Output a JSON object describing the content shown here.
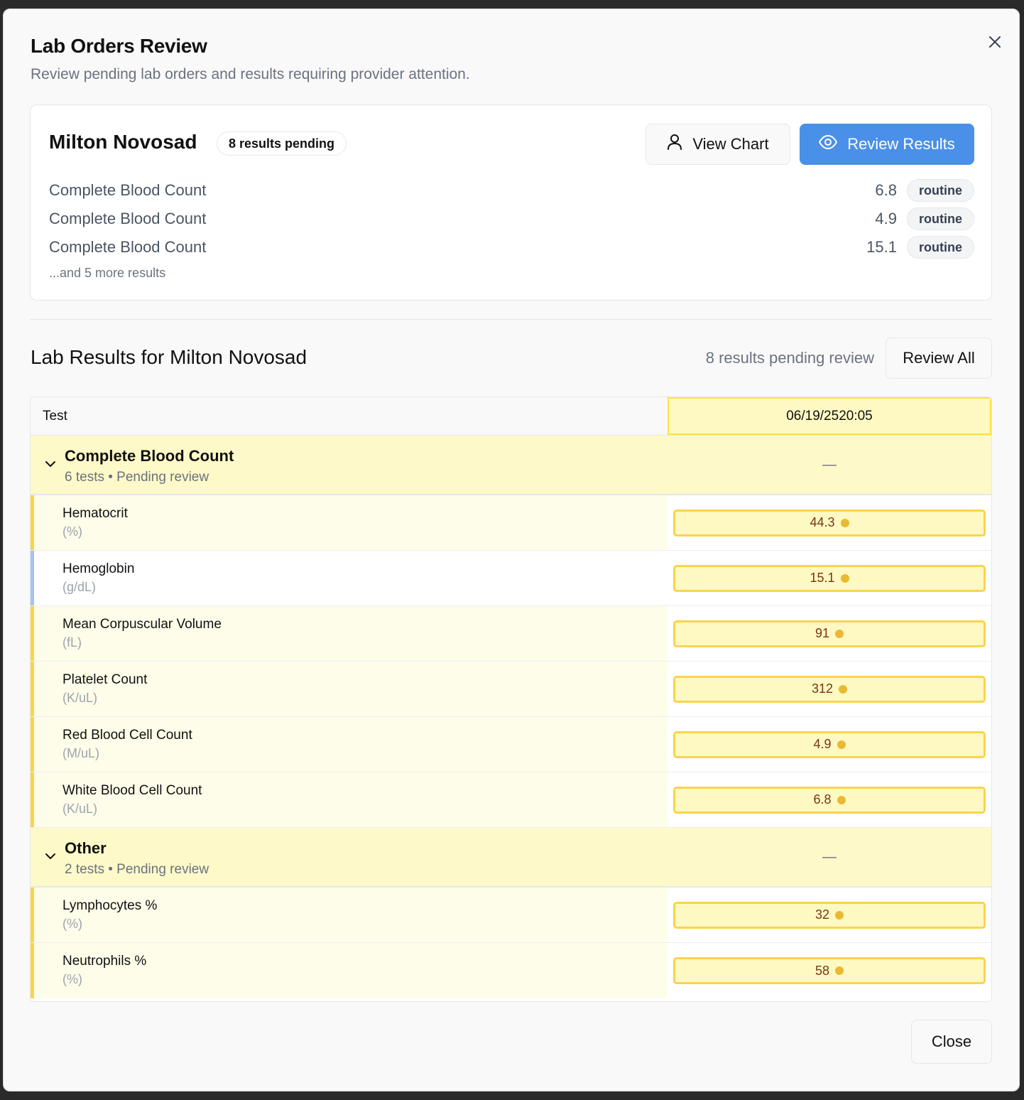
{
  "dialog": {
    "title": "Lab Orders Review",
    "subtitle": "Review pending lab orders and results requiring provider attention.",
    "close_icon": "close-icon"
  },
  "summary": {
    "patient_name": "Milton Novosad",
    "pending_badge": "8 results pending",
    "view_chart_label": "View Chart",
    "view_chart_icon": "user-icon",
    "review_results_label": "Review Results",
    "review_results_icon": "eye-icon",
    "rows": [
      {
        "name": "Complete Blood Count",
        "value": "6.8",
        "priority": "routine"
      },
      {
        "name": "Complete Blood Count",
        "value": "4.9",
        "priority": "routine"
      },
      {
        "name": "Complete Blood Count",
        "value": "15.1",
        "priority": "routine"
      }
    ],
    "more_text": "...and 5 more results"
  },
  "results": {
    "title": "Lab Results for Milton Novosad",
    "pending_text": "8 results pending review",
    "review_all_label": "Review All",
    "columns": {
      "test": "Test",
      "date": "06/19/2520:05"
    },
    "groups": [
      {
        "name": "Complete Blood Count",
        "meta": "6 tests • Pending review",
        "summary_value": "—",
        "tests": [
          {
            "name": "Hematocrit",
            "unit": "(%)",
            "value": "44.3",
            "flag": "pending"
          },
          {
            "name": "Hemoglobin",
            "unit": "(g/dL)",
            "value": "15.1",
            "flag": "normal"
          },
          {
            "name": "Mean Corpuscular Volume",
            "unit": "(fL)",
            "value": "91",
            "flag": "pending"
          },
          {
            "name": "Platelet Count",
            "unit": "(K/uL)",
            "value": "312",
            "flag": "pending"
          },
          {
            "name": "Red Blood Cell Count",
            "unit": "(M/uL)",
            "value": "4.9",
            "flag": "pending"
          },
          {
            "name": "White Blood Cell Count",
            "unit": "(K/uL)",
            "value": "6.8",
            "flag": "pending"
          }
        ]
      },
      {
        "name": "Other",
        "meta": "2 tests • Pending review",
        "summary_value": "—",
        "tests": [
          {
            "name": "Lymphocytes %",
            "unit": "(%)",
            "value": "32",
            "flag": "pending"
          },
          {
            "name": "Neutrophils %",
            "unit": "(%)",
            "value": "58",
            "flag": "pending"
          }
        ]
      }
    ]
  },
  "footer": {
    "close_label": "Close"
  },
  "colors": {
    "primary": "#4a90e8",
    "pending_highlight": "#fef9c3",
    "pending_border": "#fcd34d",
    "normal_border": "#a3c4f3"
  }
}
